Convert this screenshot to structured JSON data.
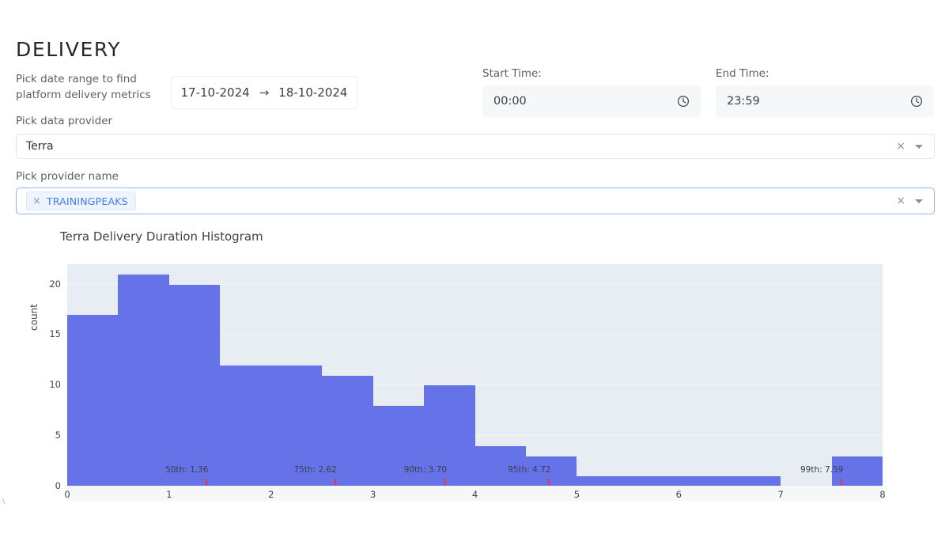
{
  "header": {
    "title": "DELIVERY"
  },
  "date_range": {
    "caption": "Pick date range to find platform delivery metrics",
    "start": "17-10-2024",
    "arrow": "→",
    "end": "18-10-2024"
  },
  "start_time": {
    "label": "Start Time:",
    "value": "00:00",
    "icon": "clock-icon"
  },
  "end_time": {
    "label": "End Time:",
    "value": "23:59",
    "icon": "clock-icon"
  },
  "data_provider": {
    "caption": "Pick data provider",
    "value": "Terra",
    "clear_glyph": "×"
  },
  "provider_name": {
    "caption": "Pick provider name",
    "chips": [
      {
        "label": "TRAININGPEAKS",
        "remove_glyph": "×"
      }
    ],
    "clear_glyph": "×"
  },
  "colors": {
    "bar": "#6673e8",
    "plot_bg": "#e8edf4",
    "grid": "#f2f5f9",
    "percentile_tick": "#e8393c",
    "chip_text": "#3d7ee8",
    "focus_border": "#8fb8f5"
  },
  "chart_data": {
    "type": "bar",
    "title": "Terra Delivery Duration Histogram",
    "xlabel": "",
    "ylabel": "count",
    "xlim": [
      0,
      8
    ],
    "ylim": [
      0,
      22
    ],
    "xticks": [
      0,
      1,
      2,
      3,
      4,
      5,
      6,
      7,
      8
    ],
    "yticks": [
      0,
      5,
      10,
      15,
      20
    ],
    "grid": true,
    "legend": null,
    "bin_width": 0.5,
    "bins": [
      {
        "x0": 0.0,
        "x1": 0.5,
        "count": 17
      },
      {
        "x0": 0.5,
        "x1": 1.0,
        "count": 21
      },
      {
        "x0": 1.0,
        "x1": 1.5,
        "count": 20
      },
      {
        "x0": 1.5,
        "x1": 2.0,
        "count": 12
      },
      {
        "x0": 2.0,
        "x1": 2.5,
        "count": 12
      },
      {
        "x0": 2.5,
        "x1": 3.0,
        "count": 11
      },
      {
        "x0": 3.0,
        "x1": 3.5,
        "count": 8
      },
      {
        "x0": 3.5,
        "x1": 4.0,
        "count": 10
      },
      {
        "x0": 4.0,
        "x1": 4.5,
        "count": 4
      },
      {
        "x0": 4.5,
        "x1": 5.0,
        "count": 3
      },
      {
        "x0": 5.0,
        "x1": 5.5,
        "count": 1
      },
      {
        "x0": 5.5,
        "x1": 6.0,
        "count": 1
      },
      {
        "x0": 6.0,
        "x1": 6.5,
        "count": 1
      },
      {
        "x0": 6.5,
        "x1": 7.0,
        "count": 1
      },
      {
        "x0": 7.0,
        "x1": 7.5,
        "count": 0
      },
      {
        "x0": 7.5,
        "x1": 8.0,
        "count": 3
      }
    ],
    "annotations": [
      {
        "name": "50th",
        "label": "50th: 1.36",
        "x": 1.36
      },
      {
        "name": "75th",
        "label": "75th: 2.62",
        "x": 2.62
      },
      {
        "name": "90th",
        "label": "90th: 3.70",
        "x": 3.7
      },
      {
        "name": "95th",
        "label": "95th: 4.72",
        "x": 4.72
      },
      {
        "name": "99th",
        "label": "99th: 7.59",
        "x": 7.59
      }
    ]
  }
}
